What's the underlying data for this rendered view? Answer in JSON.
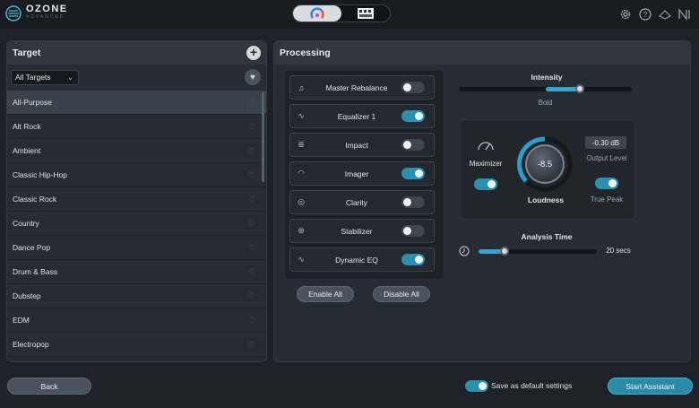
{
  "app": {
    "title": "OZONE",
    "subtitle": "ADVANCED"
  },
  "colors": {
    "accent": "#2c8fad",
    "background": "#1d2228",
    "panel": "#262c33"
  },
  "topbar": {
    "mode_tabs": [
      {
        "icon": "assistant-icon",
        "active": true
      },
      {
        "icon": "mixer-icon",
        "active": false
      }
    ],
    "icons": [
      "settings-icon",
      "help-icon",
      "izotope-icon",
      "native-instruments-icon"
    ]
  },
  "target": {
    "title": "Target",
    "filter_value": "All Targets",
    "items": [
      {
        "label": "All-Purpose",
        "selected": true
      },
      {
        "label": "Alt Rock"
      },
      {
        "label": "Ambient"
      },
      {
        "label": "Classic Hip-Hop"
      },
      {
        "label": "Classic Rock"
      },
      {
        "label": "Country"
      },
      {
        "label": "Dance Pop"
      },
      {
        "label": "Drum & Bass"
      },
      {
        "label": "Dubstep"
      },
      {
        "label": "EDM"
      },
      {
        "label": "Electropop"
      }
    ]
  },
  "processing": {
    "title": "Processing",
    "modules": [
      {
        "name": "Master Rebalance",
        "icon": "master-rebalance-icon",
        "enabled": false
      },
      {
        "name": "Equalizer 1",
        "icon": "equalizer-icon",
        "enabled": true
      },
      {
        "name": "Impact",
        "icon": "impact-icon",
        "enabled": false
      },
      {
        "name": "Imager",
        "icon": "imager-icon",
        "enabled": true
      },
      {
        "name": "Clarity",
        "icon": "clarity-icon",
        "enabled": false
      },
      {
        "name": "Stabilizer",
        "icon": "stabilizer-icon",
        "enabled": false
      },
      {
        "name": "Dynamic EQ",
        "icon": "dynamic-eq-icon",
        "enabled": true
      }
    ],
    "enable_all_label": "Enable All",
    "disable_all_label": "Disable All",
    "intensity": {
      "label": "Intensity",
      "value_label": "Bold",
      "level": 0.7
    },
    "maximizer": {
      "label": "Maximizer",
      "enabled": true,
      "loudness_value": "-8.5",
      "loudness_label": "Loudness",
      "output_level": "-0.30 dB",
      "output_level_label": "Output Level",
      "true_peak_label": "True Peak",
      "true_peak_enabled": true
    },
    "analysis": {
      "label": "Analysis Time",
      "value_label": "20 secs",
      "level": 0.22
    }
  },
  "footer": {
    "back_label": "Back",
    "save_default_label": "Save as default settings",
    "save_default_enabled": true,
    "start_label": "Start Assistant"
  }
}
